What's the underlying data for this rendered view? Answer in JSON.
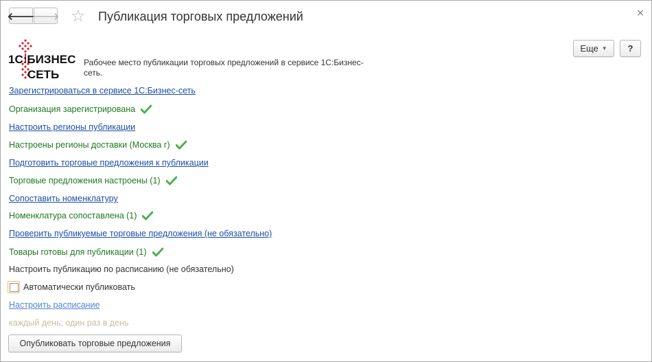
{
  "window": {
    "title": "Публикация торговых предложений",
    "close_glyph": "×"
  },
  "toolbar": {
    "back_glyph": "🡐",
    "forward_glyph": "🡒",
    "favorite_glyph": "☆",
    "more_label": "Еще",
    "help_label": "?"
  },
  "logo": {
    "line1": "1С:БИЗНЕС",
    "line2": "СЕТЬ",
    "colors": {
      "brand_red": "#d9232d",
      "text": "#111111"
    }
  },
  "header": {
    "description": "Рабочее место публикации торговых предложений в сервисе 1С:Бизнес-сеть."
  },
  "steps": {
    "register_link": "Зарегистрироваться в сервисе 1С:Бизнес-сеть",
    "org_registered": "Организация зарегистрирована",
    "setup_regions_link": "Настроить регионы публикации",
    "regions_set": "Настроены регионы доставки (Москва г)",
    "prepare_offers_link": "Подготовить торговые предложения к публикации",
    "offers_set": "Торговые предложения настроены (1)",
    "match_items_link": "Сопоставить номенклатуру",
    "items_matched": "Номенклатура сопоставлена (1)",
    "check_offers_link": "Проверить публикуемые торговые предложения (не обязательно)",
    "goods_ready": "Товары готовы для публикации (1)",
    "schedule_heading": "Настроить публикацию по расписанию (не обязательно)"
  },
  "schedule": {
    "auto_publish_label": "Автоматически публиковать",
    "auto_publish_checked": false,
    "setup_schedule_link": "Настроить расписание",
    "schedule_hint": "каждый день; один раз в день"
  },
  "actions": {
    "publish_label": "Опубликовать торговые предложения"
  },
  "colors": {
    "link": "#1c4fa8",
    "success": "#1e7a1e",
    "check_icon": "#4caf50",
    "hint": "#c8bda0",
    "focus_border": "#e3c35a"
  }
}
